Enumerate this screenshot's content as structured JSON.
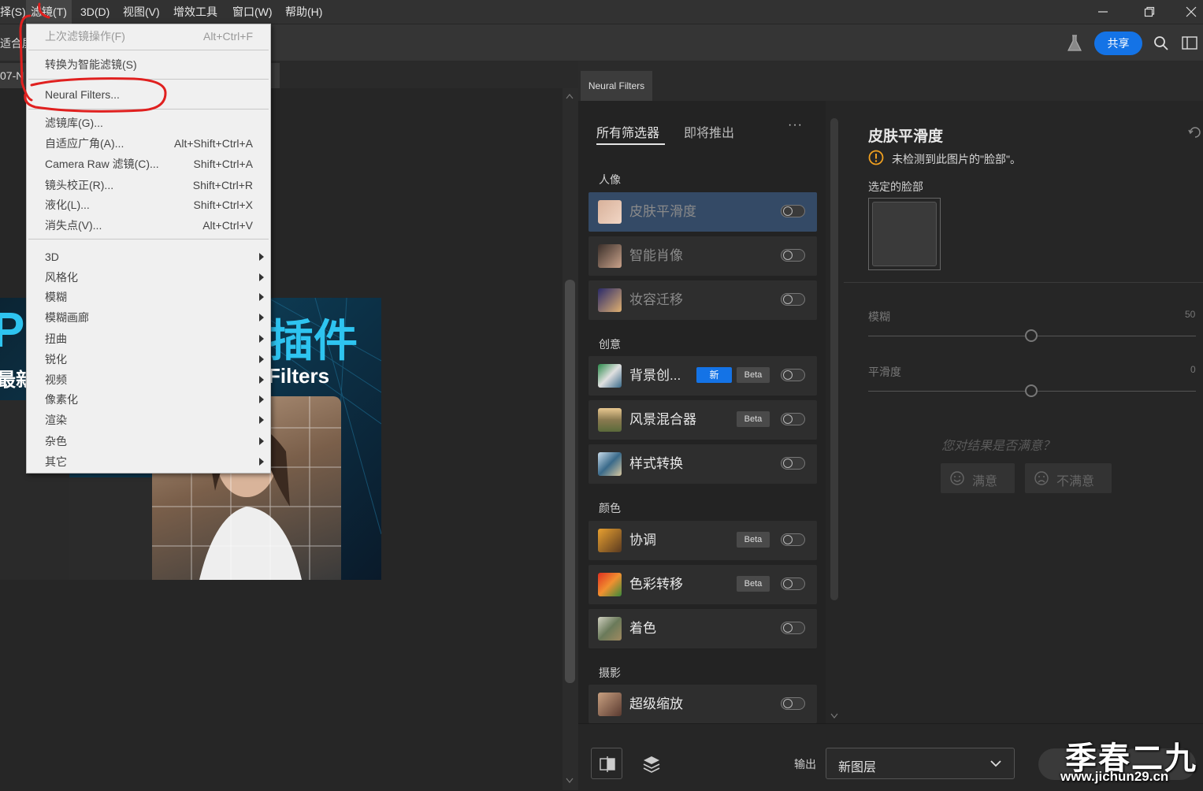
{
  "menubar": {
    "items": [
      "择(S)",
      "滤镜(T)",
      "3D(D)",
      "视图(V)",
      "增效工具",
      "窗口(W)",
      "帮助(H)"
    ]
  },
  "options_bar": {
    "left_text": "适合屏",
    "share_label": "共享"
  },
  "document": {
    "tab_label": "07-N",
    "image_text": {
      "line1": "PS",
      "line2": "插件",
      "line3": "最新",
      "line4": "Filters"
    }
  },
  "filter_menu": {
    "items": [
      {
        "label": "上次滤镜操作(F)",
        "shortcut": "Alt+Ctrl+F"
      },
      {
        "label": "转换为智能滤镜(S)",
        "shortcut": ""
      },
      {
        "label": "Neural Filters...",
        "shortcut": ""
      },
      {
        "label": "滤镜库(G)...",
        "shortcut": ""
      },
      {
        "label": "自适应广角(A)...",
        "shortcut": "Alt+Shift+Ctrl+A"
      },
      {
        "label": "Camera Raw 滤镜(C)...",
        "shortcut": "Shift+Ctrl+A"
      },
      {
        "label": "镜头校正(R)...",
        "shortcut": "Shift+Ctrl+R"
      },
      {
        "label": "液化(L)...",
        "shortcut": "Shift+Ctrl+X"
      },
      {
        "label": "消失点(V)...",
        "shortcut": "Alt+Ctrl+V"
      },
      {
        "label": "3D",
        "shortcut": ""
      },
      {
        "label": "风格化",
        "shortcut": ""
      },
      {
        "label": "模糊",
        "shortcut": ""
      },
      {
        "label": "模糊画廊",
        "shortcut": ""
      },
      {
        "label": "扭曲",
        "shortcut": ""
      },
      {
        "label": "锐化",
        "shortcut": ""
      },
      {
        "label": "视频",
        "shortcut": ""
      },
      {
        "label": "像素化",
        "shortcut": ""
      },
      {
        "label": "渲染",
        "shortcut": ""
      },
      {
        "label": "杂色",
        "shortcut": ""
      },
      {
        "label": "其它",
        "shortcut": ""
      }
    ]
  },
  "neural_filters": {
    "panel_tab": "Neural Filters",
    "tabs": [
      "所有筛选器",
      "即将推出"
    ],
    "more": "···",
    "categories": [
      "人像",
      "创意",
      "颜色",
      "摄影"
    ],
    "filters": [
      {
        "name": "皮肤平滑度",
        "badge_new": "",
        "badge_beta": ""
      },
      {
        "name": "智能肖像",
        "badge_new": "",
        "badge_beta": ""
      },
      {
        "name": "妆容迁移",
        "badge_new": "",
        "badge_beta": ""
      },
      {
        "name": "背景创...",
        "badge_new": "新",
        "badge_beta": "Beta"
      },
      {
        "name": "风景混合器",
        "badge_new": "",
        "badge_beta": "Beta"
      },
      {
        "name": "样式转换",
        "badge_new": "",
        "badge_beta": ""
      },
      {
        "name": "协调",
        "badge_new": "",
        "badge_beta": "Beta"
      },
      {
        "name": "色彩转移",
        "badge_new": "",
        "badge_beta": "Beta"
      },
      {
        "name": "着色",
        "badge_new": "",
        "badge_beta": ""
      },
      {
        "name": "超级缩放",
        "badge_new": "",
        "badge_beta": ""
      }
    ],
    "detail": {
      "title": "皮肤平滑度",
      "warning": "未检测到此图片的\"脸部\"。",
      "selected_face_label": "选定的脸部",
      "slider1_label": "模糊",
      "slider1_value": "50",
      "slider2_label": "平滑度",
      "slider2_value": "0",
      "feedback_question": "您对结果是否满意？",
      "satisfied": "满意",
      "unsatisfied": "不满意"
    },
    "bottom": {
      "output_label": "输出",
      "output_value": "新图层"
    }
  },
  "watermark": {
    "line1": "季春二九",
    "line2": "www.jichun29.cn"
  }
}
